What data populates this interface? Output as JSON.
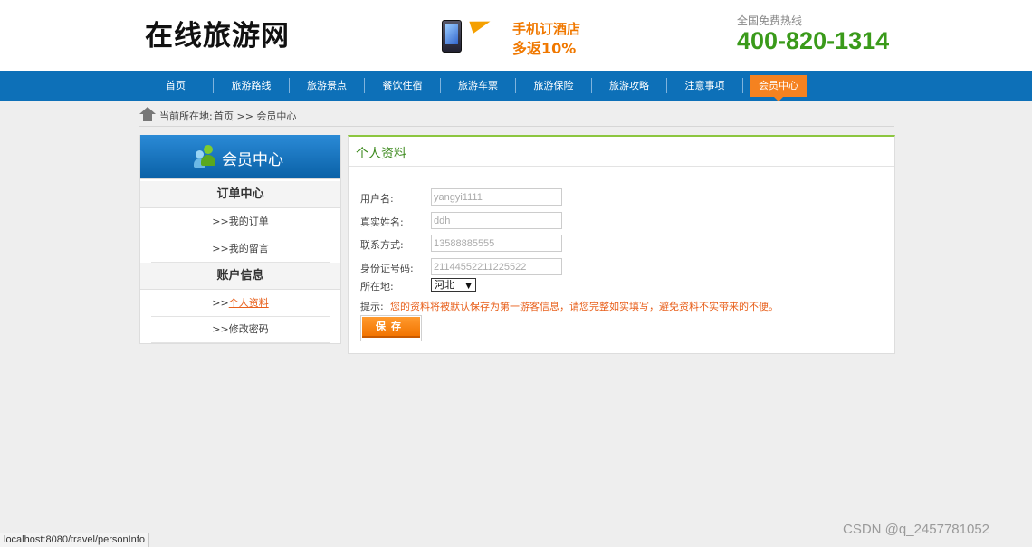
{
  "header": {
    "logo": "在线旅游网",
    "promo_line1": "手机订酒店",
    "promo_line2": "多返10%",
    "hotline_label": "全国免费热线",
    "hotline_number": "400-820-1314"
  },
  "nav": {
    "items": [
      {
        "label": "首页"
      },
      {
        "label": "旅游路线"
      },
      {
        "label": "旅游景点"
      },
      {
        "label": "餐饮住宿"
      },
      {
        "label": "旅游车票"
      },
      {
        "label": "旅游保险"
      },
      {
        "label": "旅游攻略"
      },
      {
        "label": "注意事项"
      },
      {
        "label": "会员中心"
      }
    ],
    "active_index": 8
  },
  "breadcrumb": {
    "label": "当前所在地:",
    "trail": "首页 >> 会员中心"
  },
  "sidebar": {
    "title": "会员中心",
    "sections": [
      {
        "title": "订单中心",
        "links": [
          {
            "prefix": ">>",
            "label": "我的订单"
          },
          {
            "prefix": ">>",
            "label": "我的留言"
          }
        ]
      },
      {
        "title": "账户信息",
        "links": [
          {
            "prefix": ">>",
            "label": "个人资料"
          },
          {
            "prefix": ">>",
            "label": "修改密码"
          }
        ]
      }
    ]
  },
  "panel": {
    "title": "个人资料",
    "fields": [
      {
        "label": "用户名:",
        "value": "yangyi1111"
      },
      {
        "label": "真实姓名:",
        "value": "ddh"
      },
      {
        "label": "联系方式:",
        "value": "13588885555"
      },
      {
        "label": "身份证号码:",
        "value": "21144552211225522"
      }
    ],
    "location_label": "所在地:",
    "location_value": "河北",
    "tip_label": "提示:",
    "tip_text": "您的资料将被默认保存为第一游客信息，请您完整如实填写，避免资料不实带来的不便。",
    "save_label": "保存"
  },
  "statusbar": {
    "url": "localhost:8080/travel/personInfo"
  },
  "watermark": "CSDN @q_2457781052"
}
